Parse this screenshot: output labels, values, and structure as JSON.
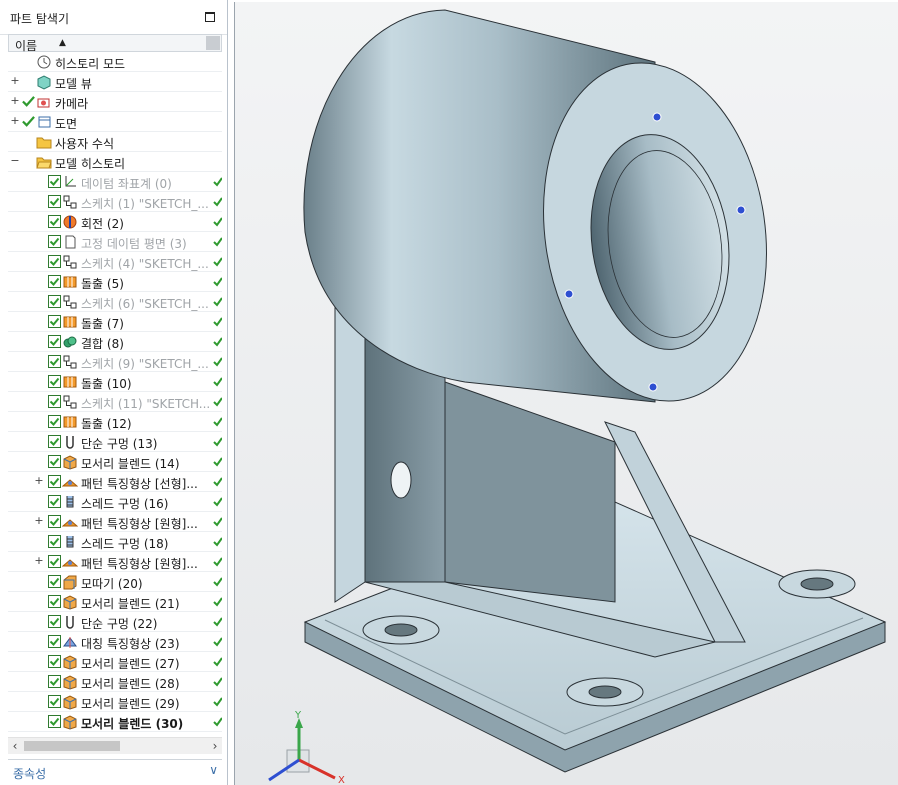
{
  "navigator": {
    "title": "파트 탐색기",
    "column_name": "이름",
    "sort_icon": "sort-ascending-icon",
    "nodes": [
      {
        "id": "history-mode",
        "label": "히스토리 모드",
        "icon": "clock-icon",
        "level": 0,
        "expander": "",
        "checked": false,
        "dim": false,
        "status": false
      },
      {
        "id": "model-view",
        "label": "모델 뷰",
        "icon": "model-views-icon",
        "level": 0,
        "expander": "+",
        "checked": false,
        "dim": false,
        "status": false
      },
      {
        "id": "camera",
        "label": "카메라",
        "icon": "camera-icon",
        "level": 0,
        "expander": "+",
        "checked": true,
        "dim": false,
        "status": false
      },
      {
        "id": "drawing",
        "label": "도면",
        "icon": "drawing-icon",
        "level": 0,
        "expander": "+",
        "checked": true,
        "dim": false,
        "status": false
      },
      {
        "id": "user-expr",
        "label": "사용자 수식",
        "icon": "folder-icon",
        "level": 0,
        "expander": "",
        "checked": false,
        "dim": false,
        "status": false
      },
      {
        "id": "model-history",
        "label": "모델 히스토리",
        "icon": "folder-open-icon",
        "level": 0,
        "expander": "−",
        "checked": false,
        "dim": false,
        "status": false
      },
      {
        "id": "f0",
        "label": "데이텀 좌표계 (0)",
        "icon": "datum-csys-icon",
        "level": 1,
        "expander": "",
        "checked": true,
        "dim": true,
        "status": true
      },
      {
        "id": "f1",
        "label": "스케치 (1) \"SKETCH_...",
        "icon": "sketch-icon",
        "level": 1,
        "expander": "",
        "checked": true,
        "dim": true,
        "status": true
      },
      {
        "id": "f2",
        "label": "회전 (2)",
        "icon": "revolve-icon",
        "level": 1,
        "expander": "",
        "checked": true,
        "dim": false,
        "status": true
      },
      {
        "id": "f3",
        "label": "고정 데이텀 평면 (3)",
        "icon": "datum-plane-icon",
        "level": 1,
        "expander": "",
        "checked": true,
        "dim": true,
        "status": true
      },
      {
        "id": "f4",
        "label": "스케치 (4) \"SKETCH_...",
        "icon": "sketch-icon",
        "level": 1,
        "expander": "",
        "checked": true,
        "dim": true,
        "status": true
      },
      {
        "id": "f5",
        "label": "돌출 (5)",
        "icon": "extrude-icon",
        "level": 1,
        "expander": "",
        "checked": true,
        "dim": false,
        "status": true
      },
      {
        "id": "f6",
        "label": "스케치 (6) \"SKETCH_...",
        "icon": "sketch-icon",
        "level": 1,
        "expander": "",
        "checked": true,
        "dim": true,
        "status": true
      },
      {
        "id": "f7",
        "label": "돌출 (7)",
        "icon": "extrude-icon",
        "level": 1,
        "expander": "",
        "checked": true,
        "dim": false,
        "status": true
      },
      {
        "id": "f8",
        "label": "결합 (8)",
        "icon": "unite-icon",
        "level": 1,
        "expander": "",
        "checked": true,
        "dim": false,
        "status": true
      },
      {
        "id": "f9",
        "label": "스케치 (9) \"SKETCH_...",
        "icon": "sketch-icon",
        "level": 1,
        "expander": "",
        "checked": true,
        "dim": true,
        "status": true
      },
      {
        "id": "f10",
        "label": "돌출 (10)",
        "icon": "extrude-icon",
        "level": 1,
        "expander": "",
        "checked": true,
        "dim": false,
        "status": true
      },
      {
        "id": "f11",
        "label": "스케치 (11) \"SKETCH...",
        "icon": "sketch-icon",
        "level": 1,
        "expander": "",
        "checked": true,
        "dim": true,
        "status": true
      },
      {
        "id": "f12",
        "label": "돌출 (12)",
        "icon": "extrude-icon",
        "level": 1,
        "expander": "",
        "checked": true,
        "dim": false,
        "status": true
      },
      {
        "id": "f13",
        "label": "단순 구멍 (13)",
        "icon": "simple-hole-icon",
        "level": 1,
        "expander": "",
        "checked": true,
        "dim": false,
        "status": true
      },
      {
        "id": "f14",
        "label": "모서리 블렌드 (14)",
        "icon": "edge-blend-icon",
        "level": 1,
        "expander": "",
        "checked": true,
        "dim": false,
        "status": true
      },
      {
        "id": "f15",
        "label": "패턴 특징형상 [선형]...",
        "icon": "pattern-icon",
        "level": 1,
        "expander": "+",
        "checked": true,
        "dim": false,
        "status": true
      },
      {
        "id": "f16",
        "label": "스레드 구멍 (16)",
        "icon": "threaded-hole-icon",
        "level": 1,
        "expander": "",
        "checked": true,
        "dim": false,
        "status": true
      },
      {
        "id": "f17",
        "label": "패턴 특징형상 [원형]...",
        "icon": "pattern-icon",
        "level": 1,
        "expander": "+",
        "checked": true,
        "dim": false,
        "status": true
      },
      {
        "id": "f18",
        "label": "스레드 구멍 (18)",
        "icon": "threaded-hole-icon",
        "level": 1,
        "expander": "",
        "checked": true,
        "dim": false,
        "status": true
      },
      {
        "id": "f19",
        "label": "패턴 특징형상 [원형]...",
        "icon": "pattern-icon",
        "level": 1,
        "expander": "+",
        "checked": true,
        "dim": false,
        "status": true
      },
      {
        "id": "f20",
        "label": "모따기 (20)",
        "icon": "chamfer-icon",
        "level": 1,
        "expander": "",
        "checked": true,
        "dim": false,
        "status": true
      },
      {
        "id": "f21",
        "label": "모서리 블렌드 (21)",
        "icon": "edge-blend-icon",
        "level": 1,
        "expander": "",
        "checked": true,
        "dim": false,
        "status": true
      },
      {
        "id": "f22",
        "label": "단순 구멍 (22)",
        "icon": "simple-hole-icon",
        "level": 1,
        "expander": "",
        "checked": true,
        "dim": false,
        "status": true
      },
      {
        "id": "f23",
        "label": "대칭 특징형상 (23)",
        "icon": "mirror-feature-icon",
        "level": 1,
        "expander": "",
        "checked": true,
        "dim": false,
        "status": true
      },
      {
        "id": "f27",
        "label": "모서리 블렌드 (27)",
        "icon": "edge-blend-icon",
        "level": 1,
        "expander": "",
        "checked": true,
        "dim": false,
        "status": true
      },
      {
        "id": "f28",
        "label": "모서리 블렌드 (28)",
        "icon": "edge-blend-icon",
        "level": 1,
        "expander": "",
        "checked": true,
        "dim": false,
        "status": true
      },
      {
        "id": "f29",
        "label": "모서리 블렌드 (29)",
        "icon": "edge-blend-icon",
        "level": 1,
        "expander": "",
        "checked": true,
        "dim": false,
        "status": true
      },
      {
        "id": "f30",
        "label": "모서리 블렌드 (30)",
        "icon": "edge-blend-icon",
        "level": 1,
        "expander": "",
        "checked": true,
        "dim": false,
        "status": true,
        "bold": true
      }
    ],
    "dependencies_label": "종속성"
  },
  "viewport": {
    "model": "pillow-block-bracket",
    "triad": {
      "x": "X",
      "y": "Y"
    }
  },
  "colors": {
    "part_face": "#b9cbd3",
    "check_green": "#2f9a2f",
    "link_blue": "#3c6fa8",
    "triad_x": "#d8322a",
    "triad_y": "#3aa64a"
  }
}
